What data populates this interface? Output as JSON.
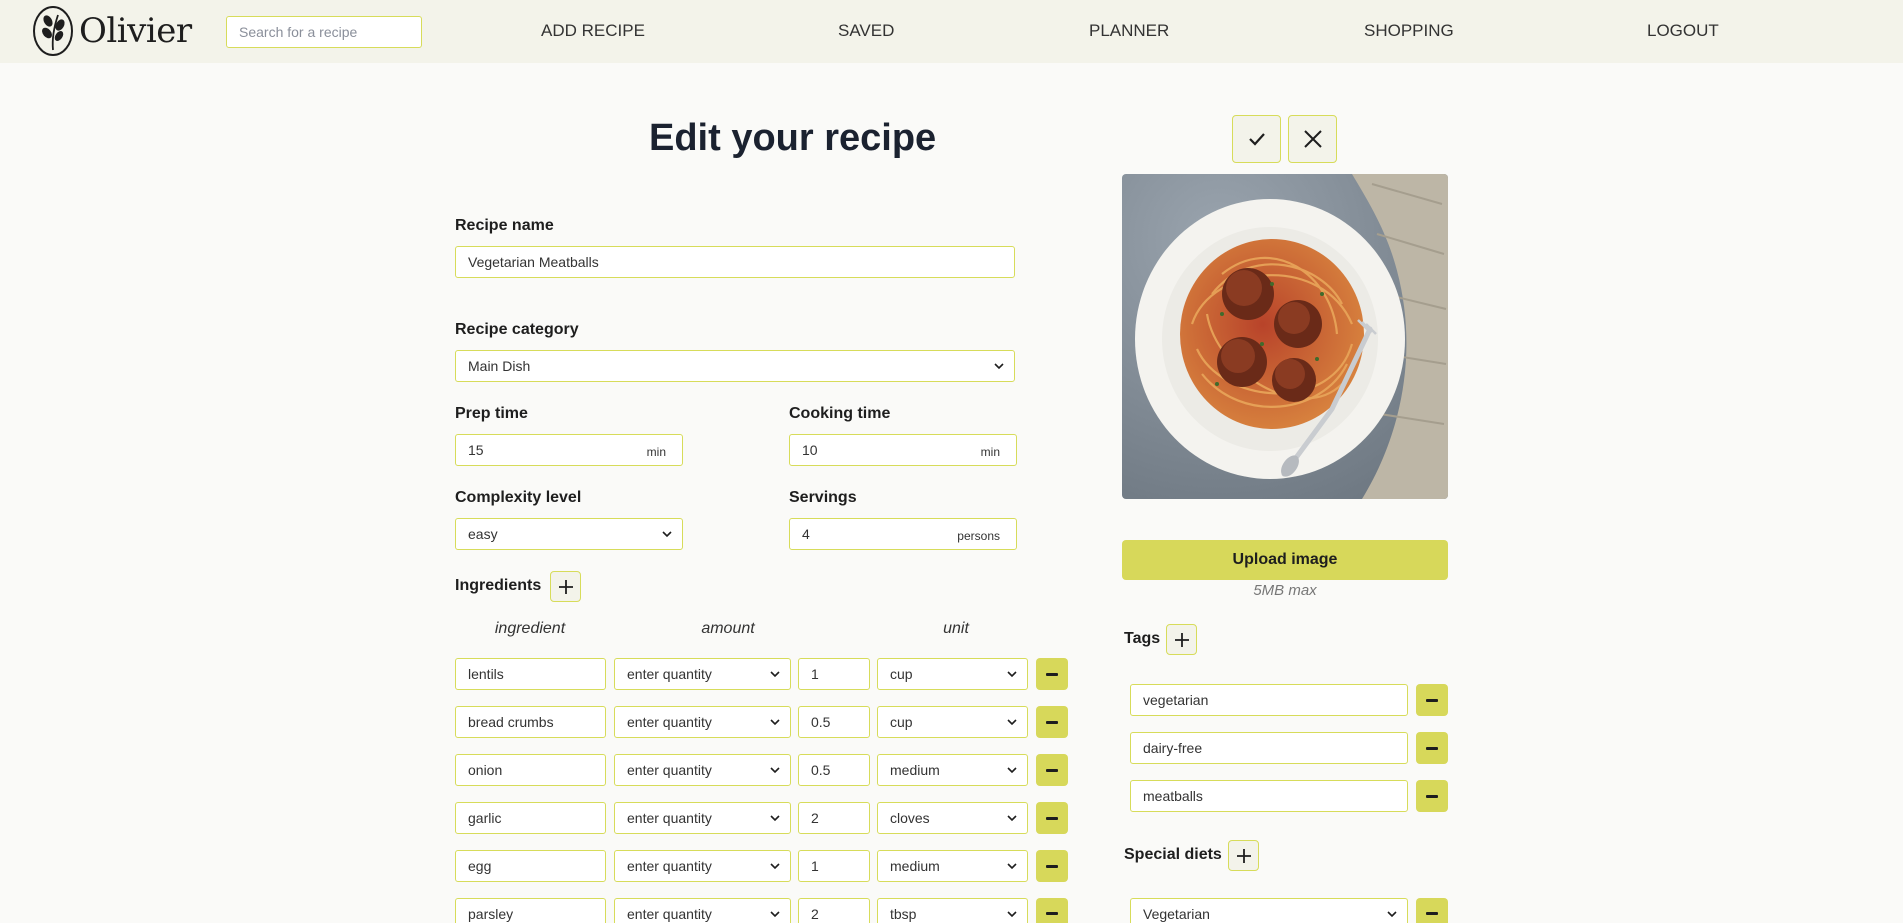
{
  "header": {
    "logo_text": "Olivier",
    "search_placeholder": "Search for a recipe",
    "nav": [
      "ADD RECIPE",
      "SAVED",
      "PLANNER",
      "SHOPPING",
      "LOGOUT"
    ]
  },
  "page_title": "Edit your recipe",
  "form": {
    "recipe_name_label": "Recipe name",
    "recipe_name": "Vegetarian Meatballs",
    "category_label": "Recipe category",
    "category": "Main Dish",
    "prep_label": "Prep time",
    "prep_value": "15",
    "prep_unit": "min",
    "cook_label": "Cooking time",
    "cook_value": "10",
    "cook_unit": "min",
    "complexity_label": "Complexity level",
    "complexity": "easy",
    "servings_label": "Servings",
    "servings_value": "4",
    "servings_unit": "persons"
  },
  "ingredients": {
    "label": "Ingredients",
    "col_ingredient": "ingredient",
    "col_amount": "amount",
    "col_unit": "unit",
    "rows": [
      {
        "name": "lentils",
        "qty_mode": "enter quantity",
        "amount": "1",
        "unit": "cup"
      },
      {
        "name": "bread crumbs",
        "qty_mode": "enter quantity",
        "amount": "0.5",
        "unit": "cup"
      },
      {
        "name": "onion",
        "qty_mode": "enter quantity",
        "amount": "0.5",
        "unit": "medium"
      },
      {
        "name": "garlic",
        "qty_mode": "enter quantity",
        "amount": "2",
        "unit": "cloves"
      },
      {
        "name": "egg",
        "qty_mode": "enter quantity",
        "amount": "1",
        "unit": "medium"
      },
      {
        "name": "parsley",
        "qty_mode": "enter quantity",
        "amount": "2",
        "unit": "tbsp"
      }
    ]
  },
  "side": {
    "upload_label": "Upload image",
    "upload_note": "5MB max",
    "tags_label": "Tags",
    "tags": [
      "vegetarian",
      "dairy-free",
      "meatballs"
    ],
    "diets_label": "Special diets",
    "diets": [
      "Vegetarian"
    ]
  },
  "colors": {
    "accent": "#d7d85a",
    "header_bg": "#f3f3ea",
    "page_bg": "#fafaf8"
  },
  "icons": [
    "olive-branch-logo-icon",
    "check-icon",
    "close-icon",
    "plus-icon",
    "minus-icon",
    "chevron-down-icon"
  ]
}
